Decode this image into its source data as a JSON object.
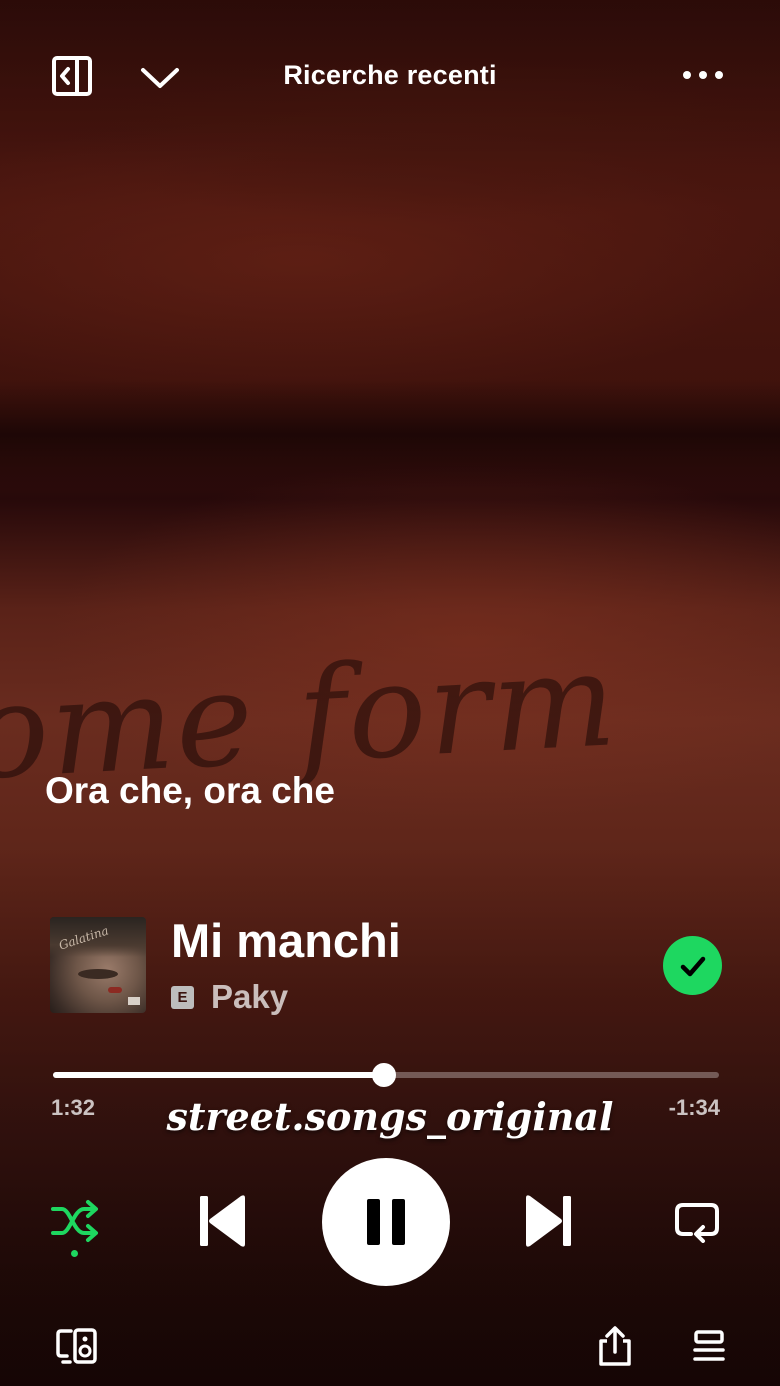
{
  "header": {
    "title": "Ricerche recenti",
    "icons": {
      "sidebar": "sidebar-toggle-icon",
      "collapse": "chevron-down-icon",
      "more": "more-options-icon"
    }
  },
  "lyric": {
    "line": "Ora che, ora che"
  },
  "track": {
    "title": "Mi manchi",
    "artist": "Paky",
    "explicit_badge": "E",
    "liked": true
  },
  "playback": {
    "elapsed": "1:32",
    "remaining": "-1:34",
    "progress_fraction": 0.497,
    "is_playing": true,
    "shuffle_enabled": true
  },
  "watermark": {
    "text": "street.songs_original"
  },
  "colors": {
    "accent": "#1ed760",
    "background": "#3a0f0b"
  }
}
